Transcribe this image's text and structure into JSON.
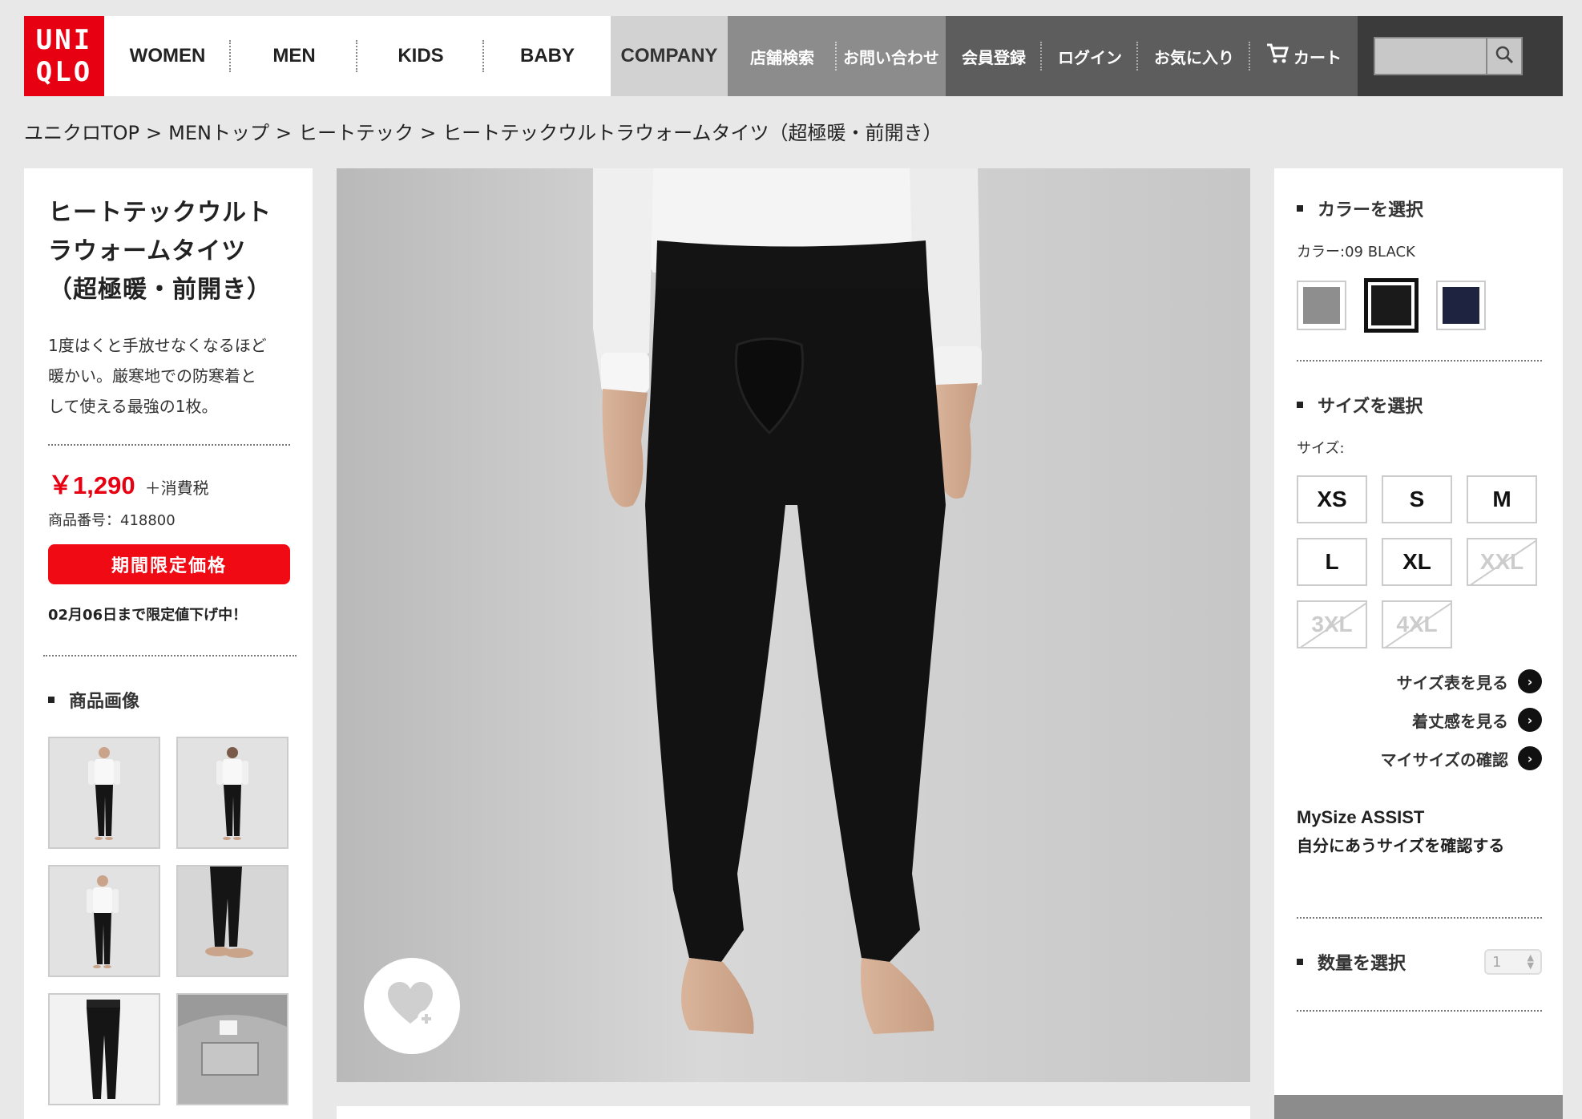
{
  "brand": {
    "logo_line1": "UNI",
    "logo_line2": "QLO",
    "accent": "#e60012"
  },
  "nav": {
    "main": [
      "WOMEN",
      "MEN",
      "KIDS",
      "BABY"
    ],
    "company": "COMPANY",
    "store_search": "店舗検索",
    "contact": "お問い合わせ",
    "register": "会員登録",
    "login": "ログイン",
    "favorites": "お気に入り",
    "cart": "カート",
    "search": {
      "placeholder": "",
      "icon": "search-icon"
    }
  },
  "breadcrumb": [
    "ユニクロTOP",
    "MENトップ",
    "ヒートテック",
    "ヒートテックウルトラウォームタイツ（超極暖・前開き）"
  ],
  "breadcrumb_separator": ">",
  "product": {
    "title_line1": "ヒートテックウルト",
    "title_line2": "ラウォームタイツ",
    "title_line3": "（超極暖・前開き）",
    "description_line1": "1度はくと手放せなくなるほど",
    "description_line2": "暖かい。厳寒地での防寒着と",
    "description_line3": "して使える最強の1枚。",
    "price": "￥1,290",
    "tax_note": "＋消費税",
    "product_code": "商品番号：418800",
    "limited_badge": "期間限定価格",
    "limited_note": "02月06日まで限定値下げ中！"
  },
  "images_section": {
    "heading": "商品画像",
    "thumbnail_count": 6
  },
  "color_section": {
    "heading": "カラーを選択",
    "selected_label": "カラー:09 BLACK",
    "swatches": [
      {
        "name": "gray",
        "color": "#8e8e8e",
        "selected": false
      },
      {
        "name": "black",
        "color": "#1a1a1a",
        "selected": true
      },
      {
        "name": "navy",
        "color": "#1e2440",
        "selected": false
      }
    ]
  },
  "size_section": {
    "heading": "サイズを選択",
    "selected_label": "サイズ:",
    "sizes": [
      {
        "label": "XS",
        "available": true
      },
      {
        "label": "S",
        "available": true
      },
      {
        "label": "M",
        "available": true
      },
      {
        "label": "L",
        "available": true
      },
      {
        "label": "XL",
        "available": true
      },
      {
        "label": "XXL",
        "available": false
      },
      {
        "label": "3XL",
        "available": false
      },
      {
        "label": "4XL",
        "available": false
      }
    ],
    "links": [
      "サイズ表を見る",
      "着丈感を見る",
      "マイサイズの確認"
    ]
  },
  "mysize": {
    "title": "MySize ASSIST",
    "subtitle": "自分にあうサイズを確認する"
  },
  "quantity": {
    "heading": "数量を選択",
    "value": "1"
  }
}
